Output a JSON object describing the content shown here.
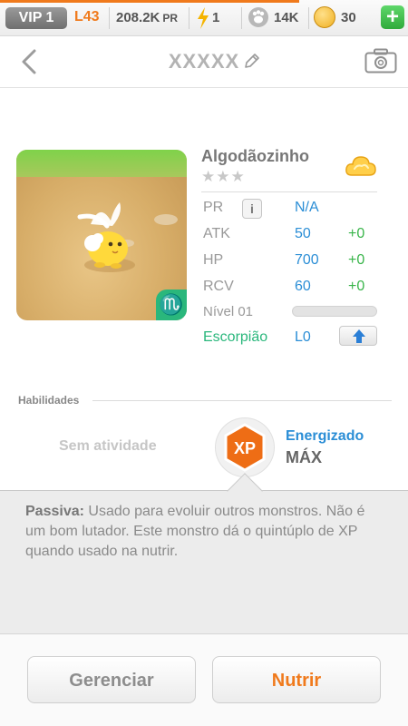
{
  "topbar": {
    "vip": "VIP 1",
    "level": "L43",
    "pr_value": "208.2K",
    "pr_suffix": "PR",
    "energy": "1",
    "food": "14K",
    "coins": "30",
    "add_label": "+"
  },
  "header": {
    "title": "XXXXX"
  },
  "monster": {
    "name": "Algodãozinho",
    "stars": "★★★",
    "zodiac_symbol": "♏",
    "stats": [
      {
        "label": "PR",
        "value": "N/A",
        "bonus": ""
      },
      {
        "label": "ATK",
        "value": "50",
        "bonus": "+0"
      },
      {
        "label": "HP",
        "value": "700",
        "bonus": "+0"
      },
      {
        "label": "RCV",
        "value": "60",
        "bonus": "+0"
      }
    ],
    "level_label": "Nível 01",
    "xp_fraction": 0,
    "sign_label": "Escorpião",
    "sign_rank": "L0",
    "info_icon_label": "i"
  },
  "abilities": {
    "section_label": "Habilidades",
    "active": "Sem atividade",
    "badge_text": "XP",
    "passive_name": "Energizado",
    "passive_level": "MÁX"
  },
  "description": {
    "lead": "Passiva:",
    "text": " Usado para evoluir outros monstros. Não é um bom lutador. Este monstro dá o quintúplo de XP quando usado na nutrir."
  },
  "buttons": {
    "manage": "Gerenciar",
    "feed": "Nutrir"
  },
  "colors": {
    "accent_orange": "#f07a1c",
    "stat_blue": "#2b8ed6",
    "bonus_green": "#39b54a",
    "zodiac_green": "#2ab77c"
  }
}
